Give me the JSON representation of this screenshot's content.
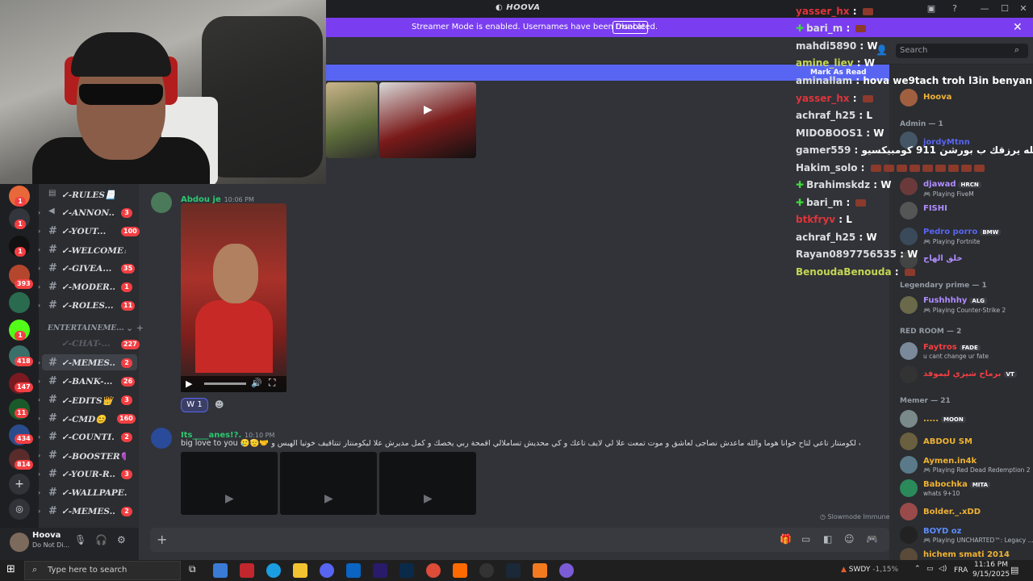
{
  "window": {
    "title": "HOOVA"
  },
  "banner": {
    "text": "Streamer Mode is enabled. Usernames have been truncated.",
    "button": "Disable"
  },
  "header": {
    "search_placeholder": "Search",
    "mark_as_read": "Mark As Read"
  },
  "server_badges": [
    "1",
    "1",
    "1",
    "393",
    "1",
    "418",
    "147",
    "11",
    "434",
    "814"
  ],
  "channels": [
    {
      "name": "✓-RULES📃",
      "badge": "",
      "icon": "rules"
    },
    {
      "name": "✓-ANNON...",
      "badge": "3",
      "icon": "announce"
    },
    {
      "name": "✓-YOUT...",
      "badge": "100",
      "icon": "hash"
    },
    {
      "name": "✓-WELCOME👋",
      "badge": "",
      "icon": "hash"
    },
    {
      "name": "✓-GIVEA...",
      "badge": "35",
      "icon": "hash"
    },
    {
      "name": "✓-MODER...",
      "badge": "1",
      "icon": "hash"
    },
    {
      "name": "✓-ROLES...",
      "badge": "11",
      "icon": "hash"
    }
  ],
  "category": "ENTERTAINEME...",
  "channels2": [
    {
      "name": "✓-CHAT-...",
      "badge": "227"
    },
    {
      "name": "✓-MEMES...",
      "badge": "2"
    },
    {
      "name": "✓-BANK-...",
      "badge": "26"
    },
    {
      "name": "✓-EDITS👑",
      "badge": "3"
    },
    {
      "name": "✓-CMD😊",
      "badge": "160"
    },
    {
      "name": "✓-COUNTI...",
      "badge": "2"
    },
    {
      "name": "✓-BOOSTER💜",
      "badge": ""
    },
    {
      "name": "✓-YOUR-R...",
      "badge": "3"
    },
    {
      "name": "✓-WALLPAPE...",
      "badge": ""
    },
    {
      "name": "✓-MEMES...",
      "badge": "2"
    }
  ],
  "user": {
    "name": "Hoova",
    "status": "Do Not Di..."
  },
  "messages": [
    {
      "author": "Abdou je",
      "time": "10:06 PM",
      "reaction": "1"
    },
    {
      "author": "Its____anes!?.",
      "time": "10:10 PM",
      "text": "big love to you 🥲🫡🤝 نشالله يسجيوك و سباقي بلي يزير لي قريبت لكومنتار تاعي لتاح خوانا هوما والله ماعدش نصاجى لعاشق و موت تمعت علا لي لايف تاعك و كي محديش تساملالي اقمحة ربي يخصك و كمل مديرش علا ليكومنتار تنتاقيف خوتيا الهبس و"
    }
  ],
  "slowmode": "Slowmode Immune",
  "chat_overlay": [
    {
      "user": "yasser_hx",
      "color": "red",
      "badge": false,
      "msg": "",
      "emote": true
    },
    {
      "user": "bari_m",
      "color": "white",
      "badge": true,
      "msg": "",
      "emote": true
    },
    {
      "user": "mahdi5890",
      "color": "white",
      "badge": false,
      "msg": "W",
      "emote": false
    },
    {
      "user": "amine_liev",
      "color": "green",
      "badge": false,
      "msg": "W",
      "emote": false
    },
    {
      "user": "aminallam",
      "color": "white",
      "badge": false,
      "msg": "hova we9tach troh l3in benyan",
      "emote": false
    },
    {
      "user": "yasser_hx",
      "color": "red",
      "badge": false,
      "msg": "",
      "emote": true
    },
    {
      "user": "achraf_h25",
      "color": "white",
      "badge": false,
      "msg": "L",
      "emote": false
    },
    {
      "user": "MIDOBOOS1",
      "color": "white",
      "badge": false,
      "msg": "W",
      "emote": false
    },
    {
      "user": "gamer559",
      "color": "white",
      "badge": false,
      "msg": "الله يرزقك ب بورشن 911 كومبيكسيو",
      "emote": false
    },
    {
      "user": "Hakim_solo",
      "color": "white",
      "badge": false,
      "msg": "",
      "emote": true
    },
    {
      "user": "Brahimskdz",
      "color": "white",
      "badge": true,
      "msg": "W",
      "emote": false
    },
    {
      "user": "bari_m",
      "color": "white",
      "badge": true,
      "msg": "",
      "emote": true
    },
    {
      "user": "btkfryv",
      "color": "red",
      "badge": false,
      "msg": "L",
      "emote": false
    },
    {
      "user": "achraf_h25",
      "color": "white",
      "badge": false,
      "msg": "W",
      "emote": false
    },
    {
      "user": "Rayan0897756535",
      "color": "white",
      "badge": false,
      "msg": "W",
      "emote": false
    },
    {
      "user": "BenoudaBenouda",
      "color": "green",
      "badge": false,
      "msg": "",
      "emote": true
    }
  ],
  "members": {
    "owner": {
      "name": "Hoova",
      "color": "#f0b232"
    },
    "admin_header": "Admin — 1",
    "admin": [
      {
        "name": "jordyMtnn",
        "activity": "",
        "color": "#5865f2",
        "tag": ""
      },
      {
        "name": "djawad",
        "activity": "Playing FiveM",
        "color": "#b08cff",
        "tag": "HRCN"
      },
      {
        "name": "FISHI",
        "activity": "",
        "color": "#b08cff",
        "tag": ""
      },
      {
        "name": "Pedro porro",
        "activity": "Playing Fortnite",
        "color": "#5865f2",
        "tag": "BMW"
      },
      {
        "name": "خلق الهاج",
        "activity": "",
        "color": "#b08cff",
        "tag": ""
      }
    ],
    "legend_header": "Legendary prime — 1",
    "legend": [
      {
        "name": "Fushhhhy",
        "activity": "Playing Counter-Strike 2",
        "color": "#b08cff",
        "tag": "ALG"
      }
    ],
    "red_header": "RED ROOM — 2",
    "red": [
      {
        "name": "Faytros",
        "activity": "u cant change ur fate",
        "color": "#f23f43",
        "tag": "FADE"
      },
      {
        "name": "برماح شيزي ليموفد",
        "activity": "",
        "color": "#f23f43",
        "tag": "VT"
      }
    ],
    "memer_header": "Memer — 21",
    "memer": [
      {
        "name": ".....",
        "activity": "",
        "color": "#f0b232",
        "tag": "MOON"
      },
      {
        "name": "ABDOU SM",
        "activity": "",
        "color": "#f0b232",
        "tag": ""
      },
      {
        "name": "Aymen.in4k",
        "activity": "Playing Red Dead Redemption 2",
        "color": "#f0b232",
        "tag": ""
      },
      {
        "name": "Babochka",
        "activity": "whats 9+10",
        "color": "#f0b232",
        "tag": "MITA"
      },
      {
        "name": "Bolder._.xDD",
        "activity": "",
        "color": "#f0b232",
        "tag": ""
      },
      {
        "name": "BOYD oz",
        "activity": "Playing UNCHARTED™: Legacy ...",
        "color": "#5b8cff",
        "tag": ""
      },
      {
        "name": "hichem smati 2014",
        "activity": "",
        "color": "#f0b232",
        "tag": ""
      }
    ]
  },
  "taskbar": {
    "search_placeholder": "Type here to search",
    "weather": "SWDY",
    "weather_change": "-1,15%",
    "lang": "FRA",
    "time": "11:16 PM",
    "date": "9/15/2025"
  }
}
